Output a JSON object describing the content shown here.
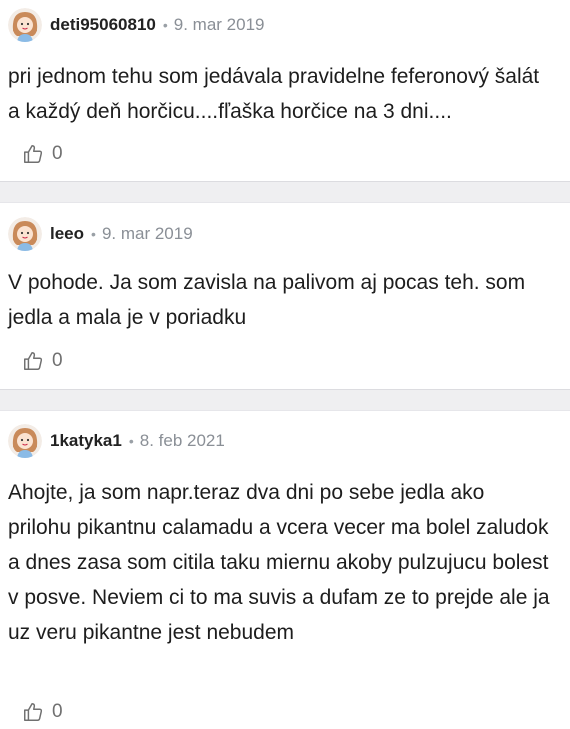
{
  "comments": [
    {
      "author": "deti95060810",
      "separator": "•",
      "date": "9. mar 2019",
      "text": "pri jednom tehu som jedávala pravidelne feferonový šalát a každý deň horčicu....fľaška horčice na 3 dni....",
      "likes": "0"
    },
    {
      "author": "leeo",
      "separator": "•",
      "date": "9. mar 2019",
      "text": "V pohode. Ja som zavisla na palivom aj pocas teh. som jedla a mala je v poriadku",
      "likes": "0"
    },
    {
      "author": "1katyka1",
      "separator": "•",
      "date": "8. feb 2021",
      "text": "Ahojte, ja som napr.teraz dva dni po sebe jedla ako prilohu pikantnu calamadu a vcera vecer ma bolel zaludok a dnes zasa som citila taku miernu akoby pulzujucu bolest v posve. Neviem ci to ma suvis a dufam ze to prejde ale ja uz veru pikantne jest nebudem",
      "likes": "0"
    }
  ],
  "icons": {
    "avatar": "girl-avatar-icon",
    "like": "thumbs-up-icon"
  },
  "colors": {
    "separator": "#efeff1",
    "date": "#8a8f96",
    "like": "#707070"
  }
}
